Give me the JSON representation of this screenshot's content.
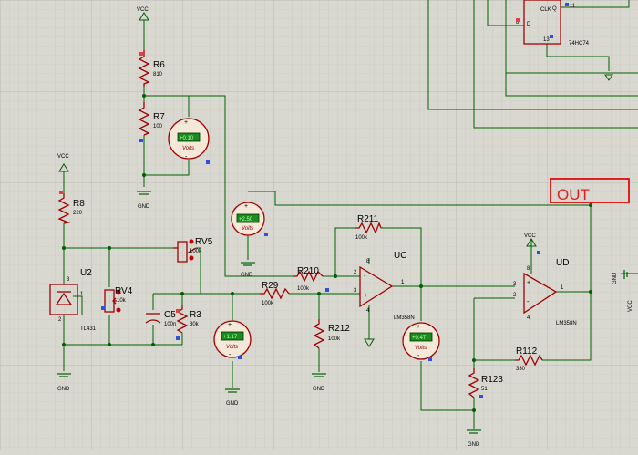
{
  "labels": {
    "vcc": "VCC",
    "gnd": "GND",
    "out": "OUT",
    "clk": "CLK",
    "chip_74hc74": "74HC74",
    "u2": "U2",
    "u2_part": "TL431",
    "r8": "R8",
    "r8_val": "220",
    "r6": "R6",
    "r6_val": "810",
    "r7": "R7",
    "r7_val": "100",
    "rv4": "RV4",
    "rv4_val": "10k",
    "rv5": "RV5",
    "rv5_val": "100k",
    "c5": "C5",
    "c5_val": "100n",
    "r3": "R3",
    "r3_val": "30k",
    "r29": "R29",
    "r29_val": "100k",
    "r210": "R210",
    "r210_val": "100k",
    "r211": "R211",
    "r211_val": "100k",
    "r212": "R212",
    "r212_val": "100k",
    "r112": "R112",
    "r112_val": "330",
    "r123": "R123",
    "r123_val": "51",
    "uc": "UC",
    "uc_part": "LM358N",
    "ud": "UD",
    "ud_part": "LM358N",
    "volts": "Volts",
    "plus": "+",
    "minus": "-"
  },
  "meters": {
    "m1": "+0.10",
    "m2": "+2.50",
    "m3": "+1.17",
    "m4": "+0.47"
  },
  "pins": {
    "u2_3": "3",
    "u2_1": "1",
    "u2_2": "2",
    "uc_8": "8",
    "uc_2": "2",
    "uc_3": "3",
    "uc_4": "4",
    "uc_1": "1",
    "ud_8": "8",
    "ud_3": "3",
    "ud_2": "2",
    "ud_4": "4",
    "ud_1": "1",
    "ff_q": "Q",
    "ff_d": "D",
    "ff_8": "8",
    "ff_11": "11",
    "ff_13": "13"
  }
}
